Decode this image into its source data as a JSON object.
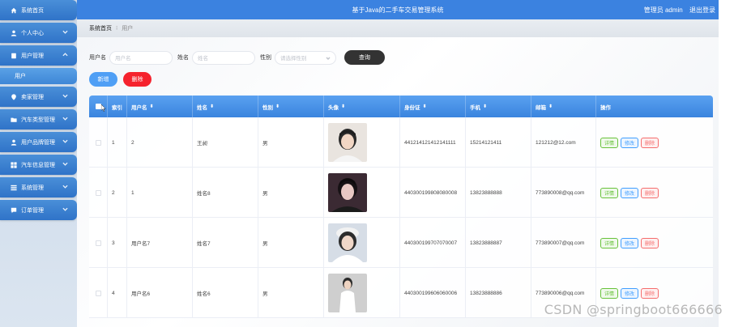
{
  "app": {
    "title": "基于Java的二手车交易管理系统",
    "user_label": "管理员 admin",
    "logout_label": "退出登录"
  },
  "sidebar": {
    "items": [
      {
        "label": "系统首页",
        "icon": "home-icon",
        "has_arrow": false
      },
      {
        "label": "个人中心",
        "icon": "user-icon",
        "has_arrow": true
      },
      {
        "label": "用户管理",
        "icon": "document-icon",
        "has_arrow": true,
        "expanded": true
      },
      {
        "label": "卖家管理",
        "icon": "location-icon",
        "has_arrow": true
      },
      {
        "label": "汽车类型管理",
        "icon": "folder-icon",
        "has_arrow": true
      },
      {
        "label": "用户品牌管理",
        "icon": "user-icon",
        "has_arrow": true
      },
      {
        "label": "汽车信息管理",
        "icon": "grid-icon",
        "has_arrow": true
      },
      {
        "label": "系统管理",
        "icon": "list-icon",
        "has_arrow": true
      },
      {
        "label": "订单管理",
        "icon": "chat-icon",
        "has_arrow": true
      }
    ],
    "submenu_label": "用户"
  },
  "breadcrumb": {
    "home": "系统首页",
    "separator": "⁝",
    "current": "用户"
  },
  "filters": {
    "username_label": "用户名",
    "username_placeholder": "用户名",
    "name_label": "姓名",
    "name_placeholder": "姓名",
    "gender_label": "性别",
    "gender_placeholder": "请选择性别",
    "query_label": "查询"
  },
  "actions": {
    "add_label": "新增",
    "delete_label": "删除"
  },
  "table": {
    "headers": [
      "索引",
      "用户名",
      "姓名",
      "性别",
      "头像",
      "身份证",
      "手机",
      "邮箱",
      "操作"
    ],
    "sort_glyph": "⬍",
    "rows": [
      {
        "index": "1",
        "username": "2",
        "name": "王昶",
        "gender": "男",
        "id_card": "441214121412141111",
        "phone": "15214121411",
        "email": "121212@12.com"
      },
      {
        "index": "2",
        "username": "1",
        "name": "姓名8",
        "gender": "男",
        "id_card": "440300199808080008",
        "phone": "13823888888",
        "email": "773890008@qq.com"
      },
      {
        "index": "3",
        "username": "用户名7",
        "name": "姓名7",
        "gender": "男",
        "id_card": "440300199707070007",
        "phone": "13823888887",
        "email": "773890007@qq.com"
      },
      {
        "index": "4",
        "username": "用户名6",
        "name": "姓名6",
        "gender": "男",
        "id_card": "440300199606060006",
        "phone": "13823888886",
        "email": "773890006@qq.com"
      }
    ],
    "op_detail": "详情",
    "op_edit": "修改",
    "op_delete": "删除"
  },
  "watermark": "CSDN @springboot666666",
  "colors": {
    "primary": "#3b82e0",
    "danger": "#f5222d",
    "dark": "#333333"
  }
}
